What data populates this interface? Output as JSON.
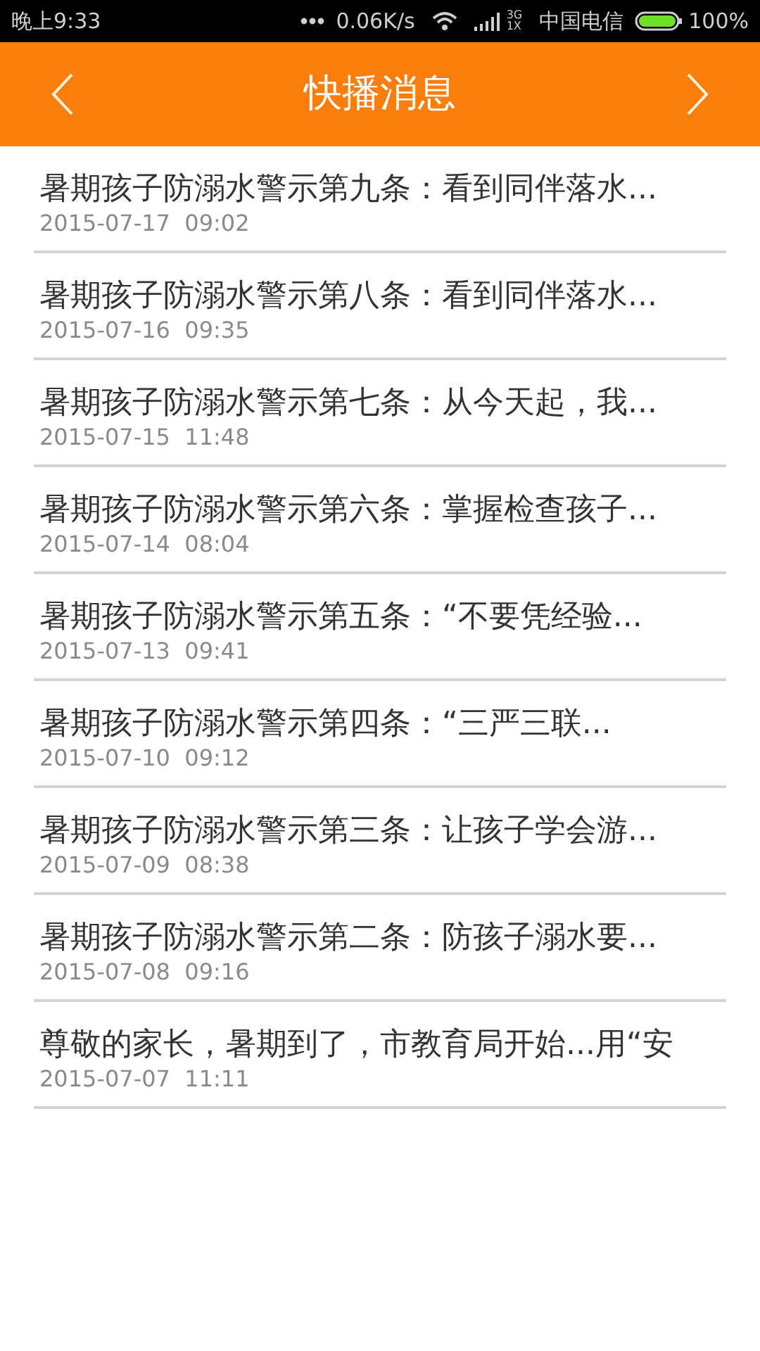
{
  "status_bar": {
    "time": "晚上9:33",
    "speed": "0.06K/s",
    "network_top": "3G",
    "network_bottom": "1X",
    "carrier": "中国电信",
    "battery": "100%"
  },
  "header": {
    "title": "快播消息"
  },
  "news": [
    {
      "title": "暑期孩子防溺水警示第九条：看到同伴落水...",
      "date": "2015-07-17  09:02"
    },
    {
      "title": "暑期孩子防溺水警示第八条：看到同伴落水...",
      "date": "2015-07-16  09:35"
    },
    {
      "title": "暑期孩子防溺水警示第七条：从今天起，我...",
      "date": "2015-07-15  11:48"
    },
    {
      "title": "暑期孩子防溺水警示第六条：掌握检查孩子...",
      "date": "2015-07-14  08:04"
    },
    {
      "title": "暑期孩子防溺水警示第五条：“不要凭经验...",
      "date": "2015-07-13  09:41"
    },
    {
      "title": "暑期孩子防溺水警示第四条：“三严三联...",
      "date": "2015-07-10  09:12"
    },
    {
      "title": "暑期孩子防溺水警示第三条：让孩子学会游...",
      "date": "2015-07-09  08:38"
    },
    {
      "title": "暑期孩子防溺水警示第二条：防孩子溺水要...",
      "date": "2015-07-08  09:16"
    },
    {
      "title": "尊敬的家长，暑期到了，市教育局开始...用“安",
      "date": "2015-07-07  11:11"
    }
  ]
}
